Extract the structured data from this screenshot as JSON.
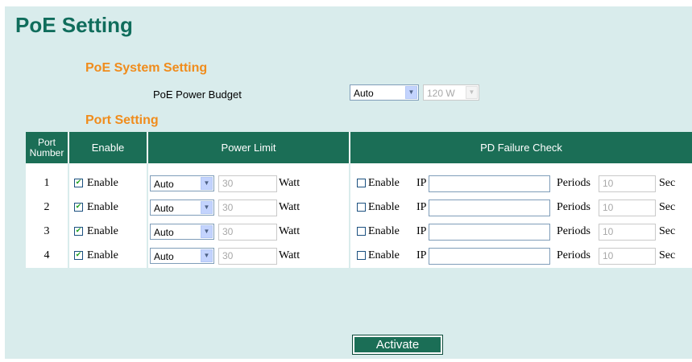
{
  "page_title": "PoE Setting",
  "system": {
    "title": "PoE System Setting",
    "budget_label": "PoE Power Budget",
    "budget_mode": "Auto",
    "budget_value": "120 W"
  },
  "port_section_title": "Port Setting",
  "table": {
    "headers": [
      "Port Number",
      "Enable",
      "Power Limit",
      "PD Failure Check"
    ],
    "rows": [
      {
        "port": "1",
        "enable_checked": true,
        "enable_label": "Enable",
        "limit_mode": "Auto",
        "limit_value": "30",
        "limit_unit": "Watt",
        "pd_checked": false,
        "pd_label": "Enable",
        "ip_label": "IP",
        "ip_value": "",
        "periods_label": "Periods",
        "periods_value": "10",
        "periods_unit": "Sec"
      },
      {
        "port": "2",
        "enable_checked": true,
        "enable_label": "Enable",
        "limit_mode": "Auto",
        "limit_value": "30",
        "limit_unit": "Watt",
        "pd_checked": false,
        "pd_label": "Enable",
        "ip_label": "IP",
        "ip_value": "",
        "periods_label": "Periods",
        "periods_value": "10",
        "periods_unit": "Sec"
      },
      {
        "port": "3",
        "enable_checked": true,
        "enable_label": "Enable",
        "limit_mode": "Auto",
        "limit_value": "30",
        "limit_unit": "Watt",
        "pd_checked": false,
        "pd_label": "Enable",
        "ip_label": "IP",
        "ip_value": "",
        "periods_label": "Periods",
        "periods_value": "10",
        "periods_unit": "Sec"
      },
      {
        "port": "4",
        "enable_checked": true,
        "enable_label": "Enable",
        "limit_mode": "Auto",
        "limit_value": "30",
        "limit_unit": "Watt",
        "pd_checked": false,
        "pd_label": "Enable",
        "ip_label": "IP",
        "ip_value": "",
        "periods_label": "Periods",
        "periods_value": "10",
        "periods_unit": "Sec"
      }
    ]
  },
  "activate_label": "Activate",
  "icons": {
    "dropdown": "chevron-down-icon",
    "checkbox_checked": "checkmark-icon"
  },
  "colors": {
    "panel_bg": "#d9ecec",
    "header_green": "#1b6e56",
    "title_green": "#106d5c",
    "section_orange": "#f08c1c"
  }
}
